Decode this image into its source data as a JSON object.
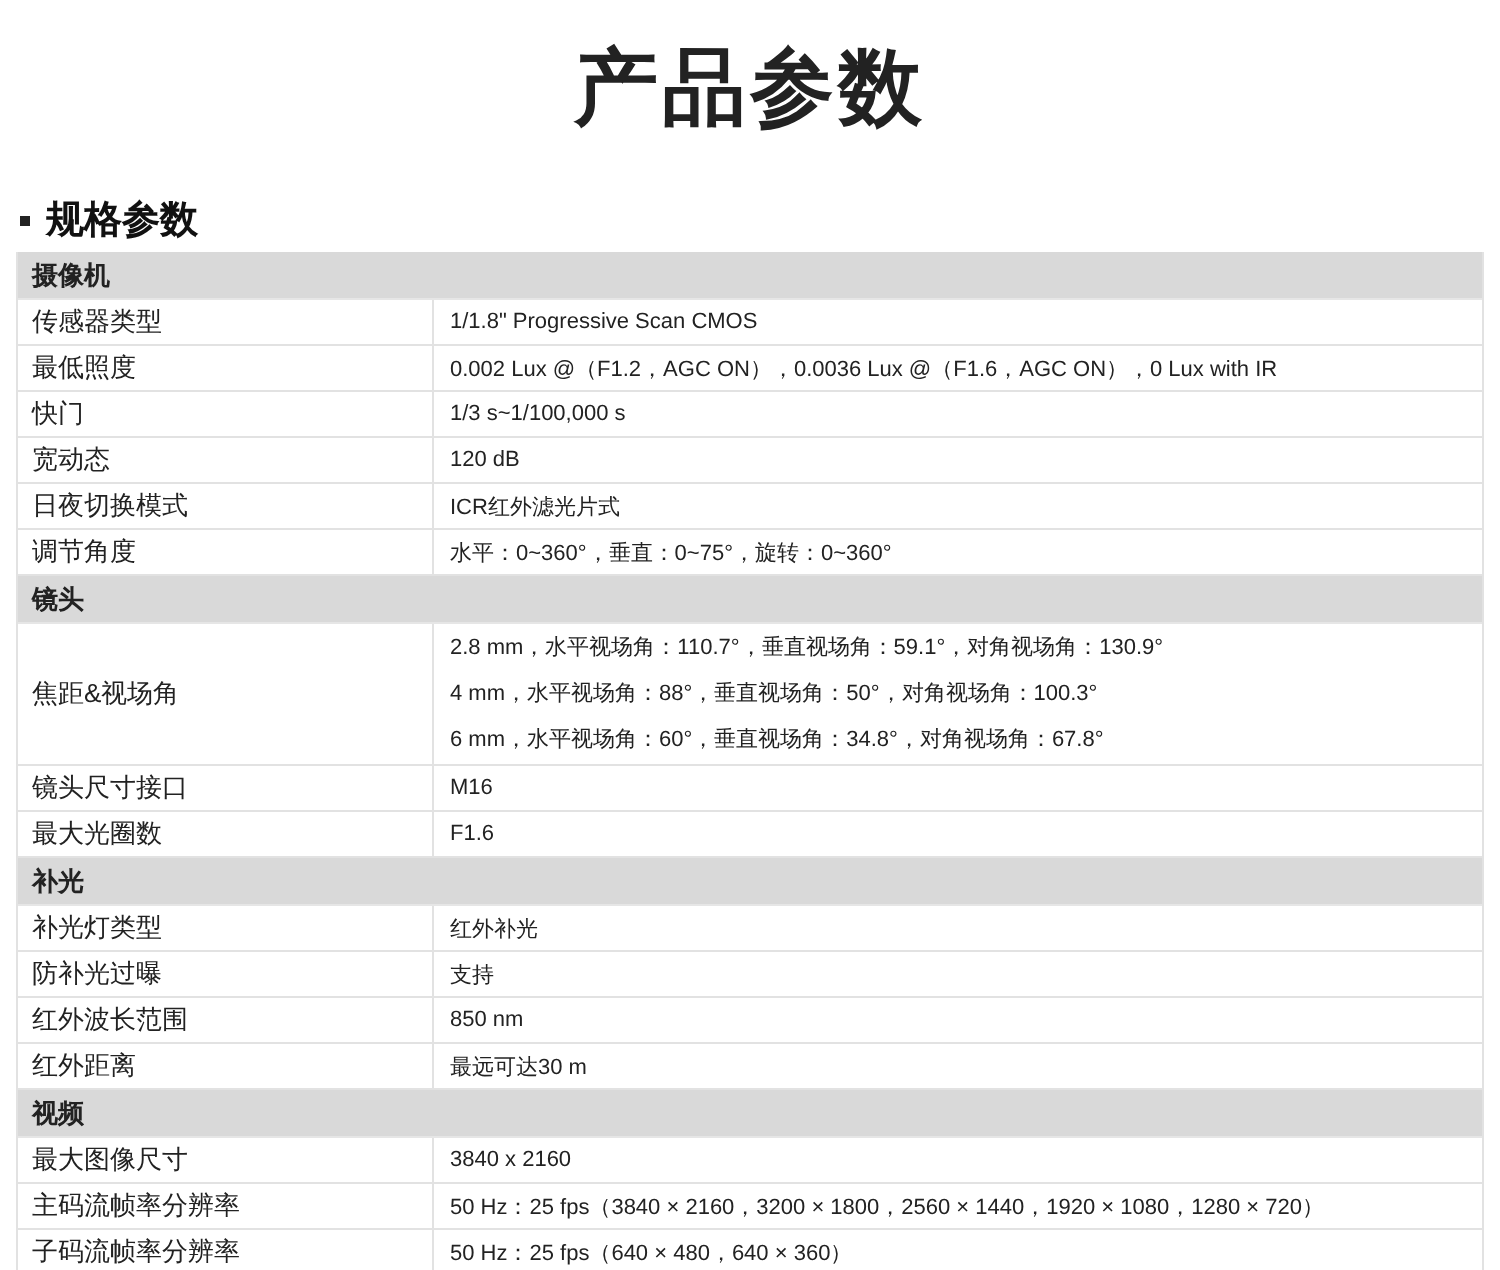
{
  "page_title": "产品参数",
  "section_title": "规格参数",
  "sections": [
    {
      "heading": "摄像机",
      "rows": [
        {
          "label": "传感器类型",
          "values": [
            "1/1.8\" Progressive Scan CMOS"
          ]
        },
        {
          "label": "最低照度",
          "values": [
            "0.002 Lux @（F1.2，AGC ON），0.0036 Lux @（F1.6，AGC ON），0 Lux with IR"
          ]
        },
        {
          "label": "快门",
          "values": [
            "1/3 s~1/100,000 s"
          ]
        },
        {
          "label": "宽动态",
          "values": [
            "120 dB"
          ]
        },
        {
          "label": "日夜切换模式",
          "values": [
            "ICR红外滤光片式"
          ]
        },
        {
          "label": "调节角度",
          "values": [
            "水平：0~360°，垂直：0~75°，旋转：0~360°"
          ]
        }
      ]
    },
    {
      "heading": "镜头",
      "rows": [
        {
          "label": "焦距&视场角",
          "values": [
            "2.8 mm，水平视场角：110.7°，垂直视场角：59.1°，对角视场角：130.9°",
            "4 mm，水平视场角：88°，垂直视场角：50°，对角视场角：100.3°",
            "6 mm，水平视场角：60°，垂直视场角：34.8°，对角视场角：67.8°"
          ]
        },
        {
          "label": "镜头尺寸接口",
          "values": [
            "M16"
          ]
        },
        {
          "label": "最大光圈数",
          "values": [
            "F1.6"
          ]
        }
      ]
    },
    {
      "heading": "补光",
      "rows": [
        {
          "label": "补光灯类型",
          "values": [
            "红外补光"
          ]
        },
        {
          "label": "防补光过曝",
          "values": [
            "支持"
          ]
        },
        {
          "label": "红外波长范围",
          "values": [
            "850 nm"
          ]
        },
        {
          "label": "红外距离",
          "values": [
            "最远可达30 m"
          ]
        }
      ]
    },
    {
      "heading": "视频",
      "rows": [
        {
          "label": "最大图像尺寸",
          "values": [
            "3840 x 2160"
          ]
        },
        {
          "label": "主码流帧率分辨率",
          "values": [
            "50 Hz：25 fps（3840 × 2160，3200 × 1800，2560 × 1440，1920 × 1080，1280 × 720）"
          ]
        },
        {
          "label": "子码流帧率分辨率",
          "values": [
            "50 Hz：25 fps（640 × 480，640 × 360）"
          ]
        }
      ]
    }
  ]
}
